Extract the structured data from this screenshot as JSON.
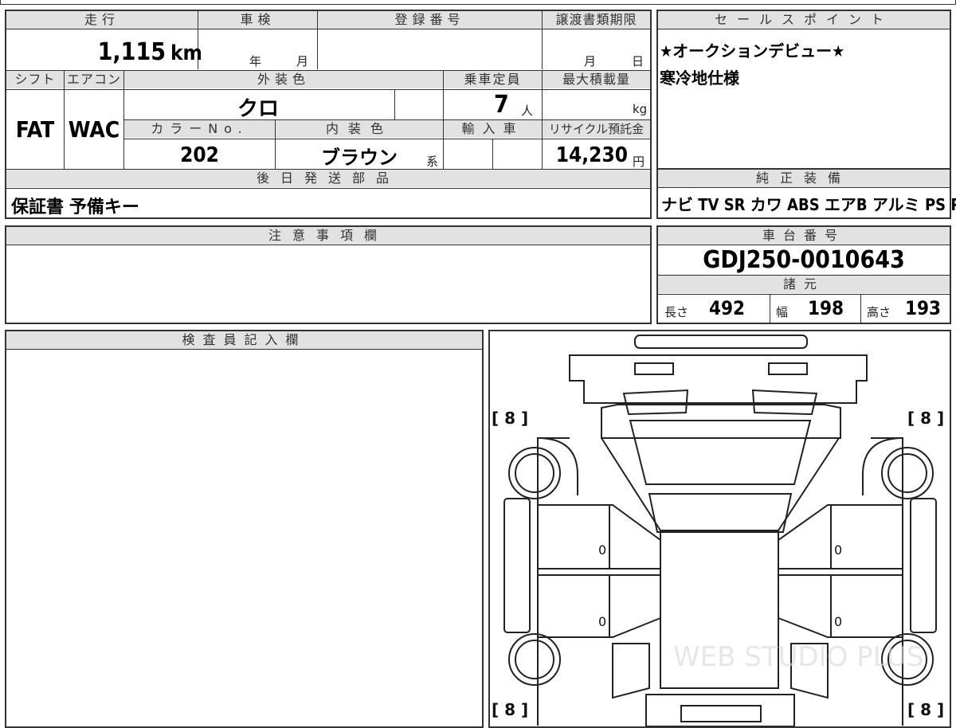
{
  "main": {
    "mileage_label": "走行",
    "mileage_value": "1,115",
    "mileage_unit": "km",
    "inspection_label": "車検",
    "inspection_year": "年",
    "inspection_month": "月",
    "registration_label": "登録番号",
    "transfer_label": "譲渡書類期限",
    "transfer_month": "月",
    "transfer_day": "日",
    "shift_label": "シフト",
    "aircon_label": "エアコン",
    "exterior_label": "外装色",
    "capacity_label": "乗車定員",
    "loadcap_label": "最大積載量",
    "shift_value": "FAT",
    "aircon_value": "WAC",
    "exterior_value": "クロ",
    "capacity_value": "7",
    "capacity_unit": "人",
    "loadcap_unit": "kg",
    "colorno_label": "カラーNo.",
    "interior_label": "内装色",
    "import_label": "輸入車",
    "recycle_label": "リサイクル預託金",
    "colorno_value": "202",
    "interior_value": "ブラウン",
    "interior_unit": "系",
    "recycle_value": "14,230",
    "recycle_unit": "円",
    "later_label": "後日発送部品",
    "later_value": "保証書 予備キー"
  },
  "sales": {
    "label": "セールスポイント",
    "line1": "★オークションデビュー★",
    "line2": "寒冷地仕様"
  },
  "equipment": {
    "label": "純正装備",
    "items": "ナビ TV SR カワ ABS エアB アルミ PS PW"
  },
  "notes": {
    "label": "注意事項欄"
  },
  "chassis": {
    "label": "車台番号",
    "value": "GDJ250-0010643",
    "spec_label": "諸元",
    "length_label": "長さ",
    "length_value": "492",
    "width_label": "幅",
    "width_value": "198",
    "height_label": "高さ",
    "height_value": "193"
  },
  "inspector": {
    "label": "検査員記入欄"
  },
  "diagram": {
    "tl": "[ 8 ]",
    "tr": "[ 8 ]",
    "bl": "[ 8 ]",
    "br": "[ 8 ]",
    "door_fl": "0",
    "door_rl": "0",
    "door_fr": "0",
    "door_rr": "0",
    "watermark": "WEB STUDIO PLUS"
  }
}
